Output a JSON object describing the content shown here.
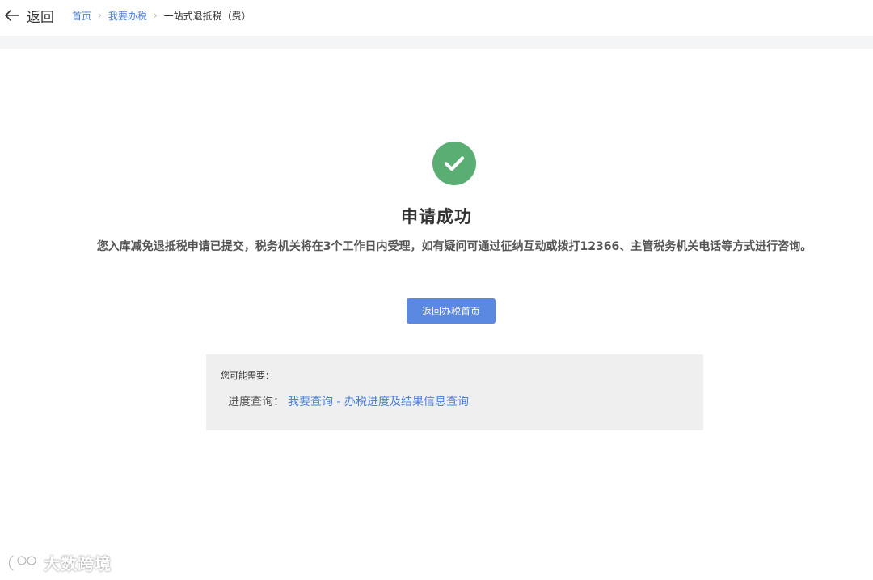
{
  "header": {
    "back_label": "返回",
    "breadcrumbs": [
      {
        "label": "首页"
      },
      {
        "label": "我要办税"
      },
      {
        "label": "一站式退抵税（费）"
      }
    ],
    "separator": "›"
  },
  "result": {
    "status": "success",
    "icon": "checkmark-circle-icon",
    "accent_color": "#5aae74",
    "title": "申请成功",
    "message": "您入库减免退抵税申请已提交，税务机关将在3个工作日内受理，如有疑问可通过征纳互动或拨打12366、主管税务机关电话等方式进行咨询。",
    "button_label": "返回办税首页",
    "button_color": "#5b88e0"
  },
  "hint": {
    "title": "您可能需要：",
    "label": "进度查询：",
    "link": "我要查询 - 办税进度及结果信息查询"
  },
  "watermark": {
    "text": "大数跨境"
  }
}
